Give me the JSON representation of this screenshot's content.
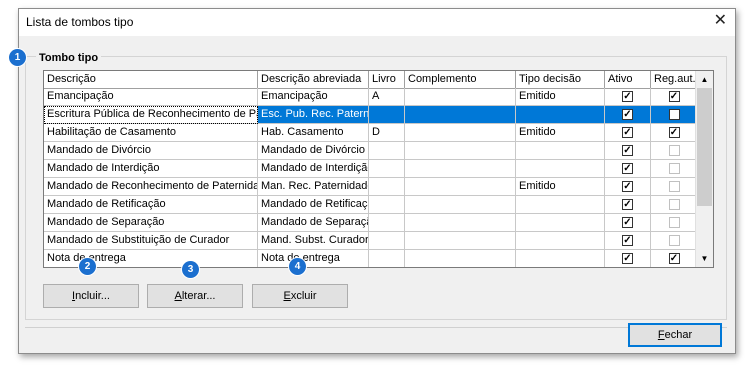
{
  "window": {
    "title": "Lista de tombos tipo",
    "close_glyph": "✕"
  },
  "group": {
    "title": "Tombo tipo"
  },
  "table": {
    "columns": [
      "Descrição",
      "Descrição abreviada",
      "Livro",
      "Complemento",
      "Tipo decisão",
      "Ativo",
      "Reg.aut."
    ],
    "rows": [
      {
        "descricao": "Emancipação",
        "abreviada": "Emancipação",
        "livro": "A",
        "complemento": "",
        "tipo": "Emitido",
        "ativo": true,
        "regaut": true,
        "regaut_enabled": true
      },
      {
        "descricao": "Escritura Pública de Reconhecimento de Paternidade",
        "abreviada": "Esc. Pub. Rec. Paternidade",
        "livro": "",
        "complemento": "",
        "tipo": "",
        "ativo": true,
        "regaut": false,
        "regaut_enabled": true,
        "selected": true
      },
      {
        "descricao": "Habilitação de Casamento",
        "abreviada": "Hab. Casamento",
        "livro": "D",
        "complemento": "",
        "tipo": "Emitido",
        "ativo": true,
        "regaut": true,
        "regaut_enabled": true
      },
      {
        "descricao": "Mandado de Divórcio",
        "abreviada": "Mandado de Divórcio",
        "livro": "",
        "complemento": "",
        "tipo": "",
        "ativo": true,
        "regaut": false,
        "regaut_enabled": false
      },
      {
        "descricao": "Mandado de Interdição",
        "abreviada": "Mandado de Interdição",
        "livro": "",
        "complemento": "",
        "tipo": "",
        "ativo": true,
        "regaut": false,
        "regaut_enabled": false
      },
      {
        "descricao": "Mandado de Reconhecimento de Paternidade",
        "abreviada": "Man. Rec. Paternidade",
        "livro": "",
        "complemento": "",
        "tipo": "Emitido",
        "ativo": true,
        "regaut": false,
        "regaut_enabled": false
      },
      {
        "descricao": "Mandado de Retificação",
        "abreviada": "Mandado de Retificação",
        "livro": "",
        "complemento": "",
        "tipo": "",
        "ativo": true,
        "regaut": false,
        "regaut_enabled": false
      },
      {
        "descricao": "Mandado de Separação",
        "abreviada": "Mandado de Separação",
        "livro": "",
        "complemento": "",
        "tipo": "",
        "ativo": true,
        "regaut": false,
        "regaut_enabled": false
      },
      {
        "descricao": "Mandado de Substituição de Curador",
        "abreviada": "Mand. Subst. Curador",
        "livro": "",
        "complemento": "",
        "tipo": "",
        "ativo": true,
        "regaut": false,
        "regaut_enabled": false
      },
      {
        "descricao": "Nota de entrega",
        "abreviada": "Nota de entrega",
        "livro": "",
        "complemento": "",
        "tipo": "",
        "ativo": true,
        "regaut": true,
        "regaut_enabled": true
      }
    ]
  },
  "buttons": {
    "incluir": {
      "pre": "",
      "key": "I",
      "post": "ncluir..."
    },
    "alterar": {
      "pre": "",
      "key": "A",
      "post": "lterar..."
    },
    "excluir": {
      "pre": "",
      "key": "E",
      "post": "xcluir"
    },
    "fechar": {
      "pre": "",
      "key": "F",
      "post": "echar"
    }
  },
  "badges": [
    "1",
    "2",
    "3",
    "4"
  ],
  "colors": {
    "selection": "#0078d7",
    "badge": "#1b6fcf"
  }
}
